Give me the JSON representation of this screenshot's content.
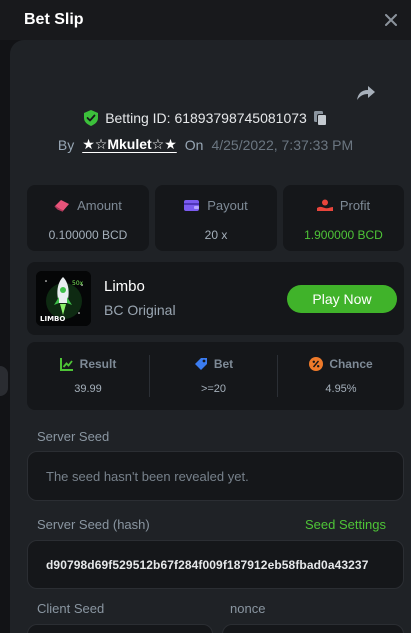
{
  "header": {
    "title": "Bet Slip"
  },
  "bet": {
    "id_label": "Betting ID: 6189379874508107​3",
    "by_label": "By",
    "username": "★☆Mkulet☆★",
    "on_label": "On",
    "date": "4/25/2022, 7:37:33 PM"
  },
  "stats": {
    "amount": {
      "label": "Amount",
      "value": "0.100000 BCD"
    },
    "payout": {
      "label": "Payout",
      "value": "20 x"
    },
    "profit": {
      "label": "Profit",
      "value": "1.900000 BCD"
    }
  },
  "game": {
    "name": "Limbo",
    "subtitle": "BC Original",
    "play_label": "Play Now",
    "thumb_label": "LIMBO",
    "thumb_badge": "50x"
  },
  "result": {
    "result": {
      "label": "Result",
      "value": "39.99"
    },
    "bet": {
      "label": "Bet",
      "value": ">=20"
    },
    "chance": {
      "label": "Chance",
      "value": "4.95%"
    }
  },
  "seeds": {
    "server_seed_label": "Server Seed",
    "server_seed_value": "The seed hasn't been revealed yet.",
    "server_hash_label": "Server Seed (hash)",
    "seed_settings_label": "Seed Settings",
    "server_hash_value": "d90798d69f529512b67f284f009f187912eb58fbad0a43237",
    "client_seed_label": "Client Seed",
    "nonce_label": "nonce"
  },
  "colors": {
    "accent_green": "#40b32a",
    "profit_green": "#4ec437",
    "panel": "#1f2226",
    "card": "#15171a"
  },
  "icons": {
    "close": "close-icon",
    "share": "share-icon",
    "verified": "shield-check-icon",
    "copy": "copy-icon",
    "amount": "money-wing-icon",
    "payout": "wallet-icon",
    "profit": "profit-icon",
    "result": "result-chart-icon",
    "bet": "tag-icon",
    "chance": "percent-icon"
  }
}
